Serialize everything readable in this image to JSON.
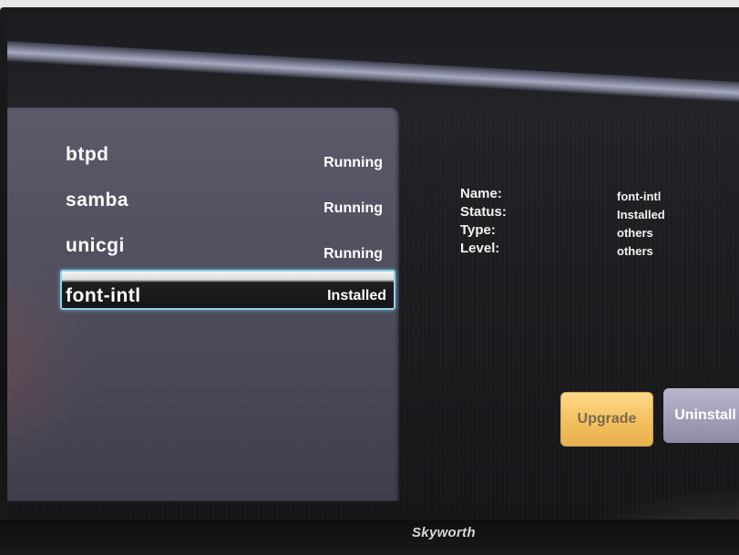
{
  "services": [
    {
      "name": "btpd",
      "status": "Running"
    },
    {
      "name": "samba",
      "status": "Running"
    },
    {
      "name": "unicgi",
      "status": "Running"
    },
    {
      "name": "font-intl",
      "status": "Installed",
      "selected": true
    }
  ],
  "details": {
    "name_label": "Name:",
    "status_label": "Status:",
    "type_label": "Type:",
    "level_label": "Level:",
    "name_value": "font-intl",
    "status_value": "Installed",
    "type_value": "others",
    "level_value": "others"
  },
  "buttons": {
    "upgrade_label": "Upgrade",
    "uninstall_label": "Uninstall"
  },
  "brand": "Skyworth",
  "colors": {
    "selection_border": "#8fd3ea",
    "upgrade_button": "#f4c262",
    "uninstall_button": "#a3a1b9"
  }
}
